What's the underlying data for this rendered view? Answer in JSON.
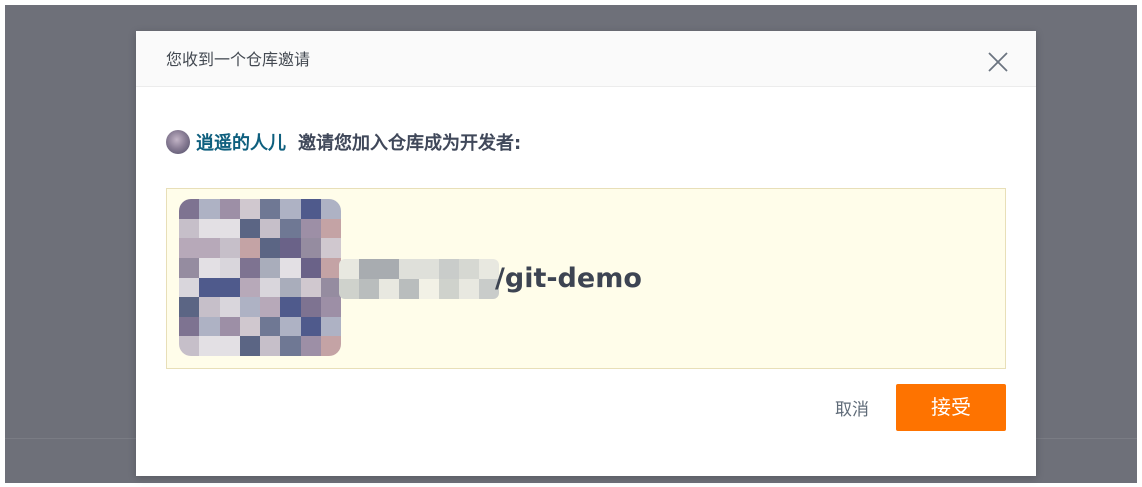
{
  "modal": {
    "title": "您收到一个仓库邀请",
    "close_icon": "close-icon"
  },
  "invite": {
    "inviter_name": "逍遥的人儿",
    "message": "邀请您加入仓库成为开发者:"
  },
  "repo": {
    "name": "/git-demo"
  },
  "actions": {
    "cancel_label": "取消",
    "accept_label": "接受"
  },
  "colors": {
    "accent": "#fe7300",
    "link": "#0e5f7e",
    "repo_box_bg": "#fffdea",
    "overlay": "#6e7079"
  }
}
